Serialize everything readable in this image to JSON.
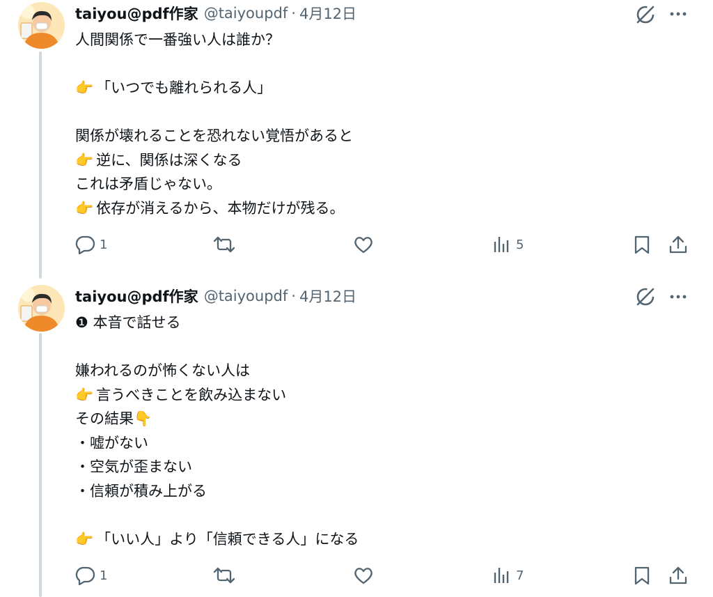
{
  "tweets": [
    {
      "author": {
        "name": "taiyou@pdf作家",
        "handle": "@taiyoupdf",
        "separator": "·",
        "date": "4月12日"
      },
      "lines": [
        {
          "text": "人間関係で一番強い人は誰か？"
        },
        {
          "text": ""
        },
        {
          "emoji": "👉",
          "text": "「いつでも離れられる人」"
        },
        {
          "text": ""
        },
        {
          "text": "関係が壊れることを恐れない覚悟があると"
        },
        {
          "emoji": "👉",
          "text": "逆に、関係は深くなる"
        },
        {
          "text": "これは矛盾じゃない。"
        },
        {
          "emoji": "👉",
          "text": "依存が消えるから、本物だけが残る。"
        }
      ],
      "actions": {
        "reply_count": "1",
        "retweet_count": "",
        "like_count": "",
        "view_count": "5"
      }
    },
    {
      "author": {
        "name": "taiyou@pdf作家",
        "handle": "@taiyoupdf",
        "separator": "·",
        "date": "4月12日"
      },
      "lines": [
        {
          "text": "❶ 本音で話せる"
        },
        {
          "text": ""
        },
        {
          "text": "嫌われるのが怖くない人は"
        },
        {
          "emoji": "👉",
          "text": "言うべきことを飲み込まない"
        },
        {
          "text": "その結果",
          "emoji_after": "👇"
        },
        {
          "text": "・嘘がない"
        },
        {
          "text": "・空気が歪まない"
        },
        {
          "text": "・信頼が積み上がる"
        },
        {
          "text": ""
        },
        {
          "emoji": "👉",
          "text": "「いい人」より「信頼できる人」になる"
        }
      ],
      "actions": {
        "reply_count": "1",
        "retweet_count": "",
        "like_count": "",
        "view_count": "7"
      }
    }
  ],
  "icons": {
    "reply": "reply-icon",
    "retweet": "retweet-icon",
    "like": "like-icon",
    "views": "views-icon",
    "bookmark": "bookmark-icon",
    "share": "share-icon",
    "grok": "grok-icon",
    "more": "more-icon"
  }
}
